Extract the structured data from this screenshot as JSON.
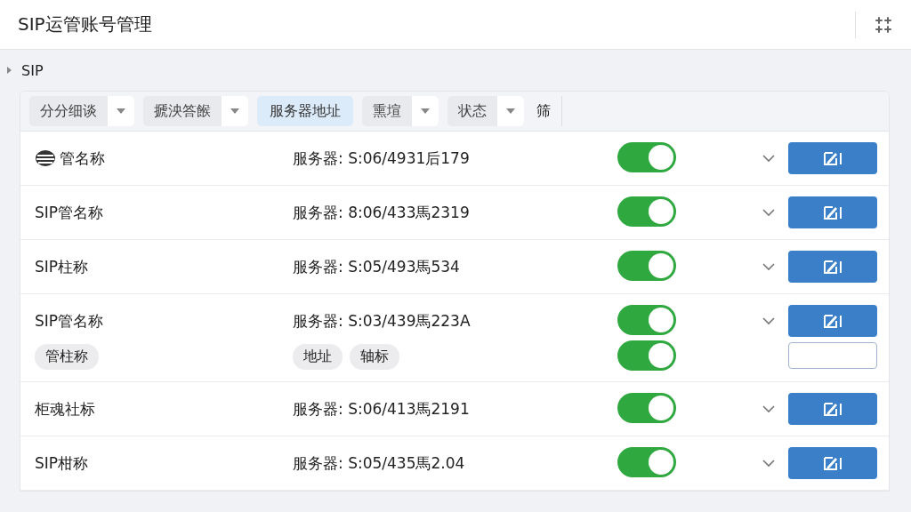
{
  "header": {
    "title": "SIP运管账号管理"
  },
  "tree": {
    "label": "SIP",
    "expanded": false
  },
  "filters": [
    {
      "label": "分分细谈",
      "kind": "dropdown",
      "selected": false
    },
    {
      "label": "搋泱答餱",
      "kind": "dropdown",
      "selected": false
    },
    {
      "label": "服务器地址",
      "kind": "plain",
      "selected": true
    },
    {
      "label": "熏塇",
      "kind": "dropdown",
      "selected": false
    },
    {
      "label": "状态",
      "kind": "dropdown",
      "selected": false
    },
    {
      "label": "筛",
      "kind": "text",
      "selected": false
    }
  ],
  "rows": [
    {
      "name": "管名称",
      "has_icon": true,
      "server": "服务器: S:06/4931后179",
      "on": true,
      "expanded": false
    },
    {
      "name": "SIP管名称",
      "has_icon": false,
      "server": "服务器: 8:06/433馬2319",
      "on": true,
      "expanded": false
    },
    {
      "name": "SIP柱称",
      "has_icon": false,
      "server": "服务器: S:05/493馬534",
      "on": true,
      "expanded": false
    },
    {
      "name": "SIP管名称",
      "has_icon": false,
      "server": "服务器: S:03/439馬223A",
      "on": true,
      "expanded": true,
      "name_tags": [
        "管柱称"
      ],
      "server_tags": [
        "地址",
        "轴标"
      ],
      "second_on": true
    },
    {
      "name": "柜魂社标",
      "has_icon": false,
      "server": "服务器: S:06/413馬2191",
      "on": true,
      "expanded": false
    },
    {
      "name": "SIP柑称",
      "has_icon": false,
      "server": "服务器: S:05/435馬2.04",
      "on": true,
      "expanded": false
    }
  ]
}
